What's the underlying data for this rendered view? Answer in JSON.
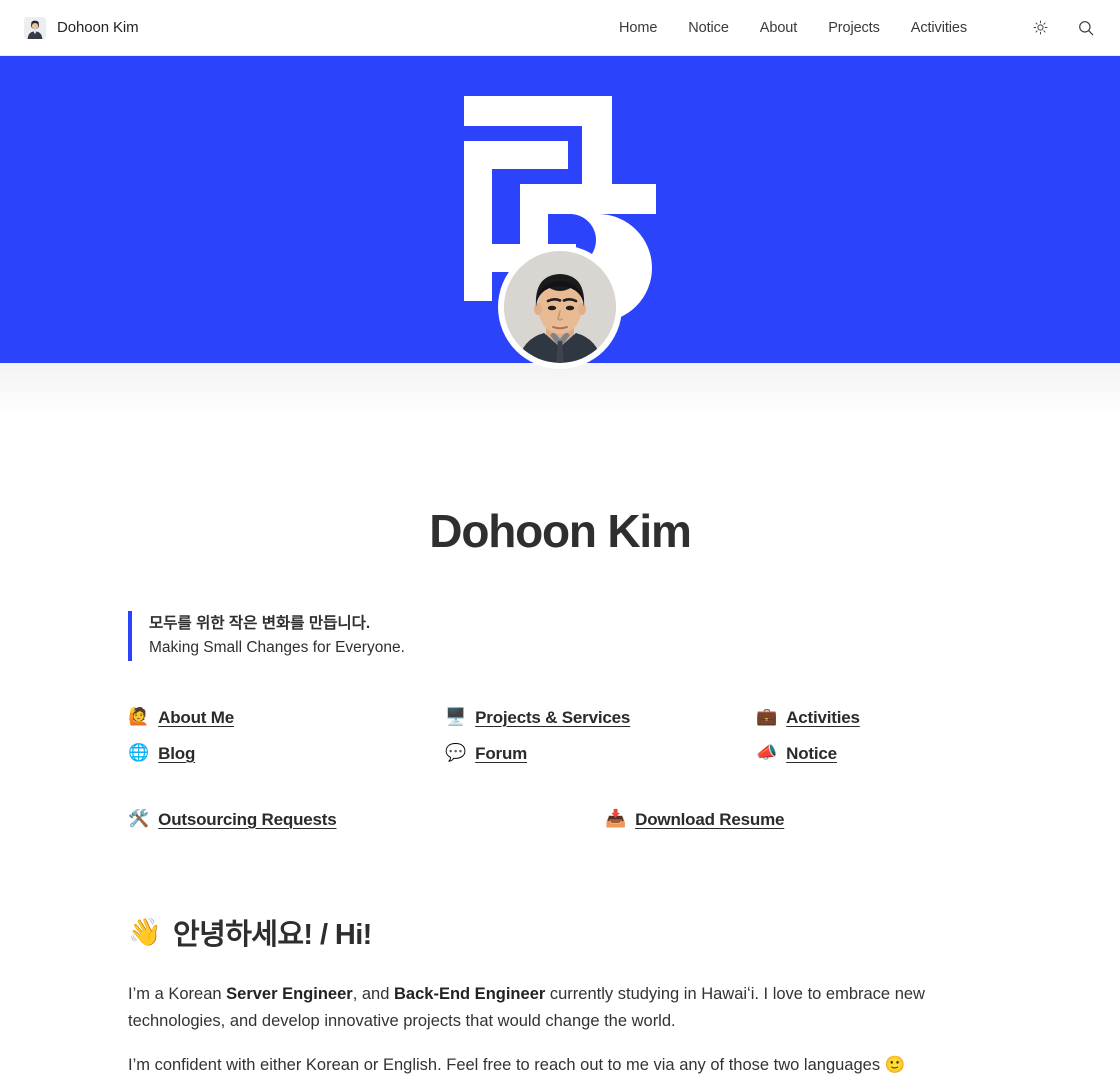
{
  "header": {
    "brand_name": "Dohoon Kim",
    "brand_avatar_icon": "user-photo-thumbnail",
    "nav_items": [
      {
        "label": "Home"
      },
      {
        "label": "Notice"
      },
      {
        "label": "About"
      },
      {
        "label": "Projects"
      },
      {
        "label": "Activities"
      }
    ],
    "theme_toggle_icon": "sun-icon",
    "search_icon": "search-icon"
  },
  "banner": {
    "background_color": "#2b44fb",
    "logo_icon": "stylized-korean-monogram-logo",
    "avatar_icon": "profile-portrait-photo"
  },
  "hero": {
    "title": "Dohoon Kim",
    "quote_ko": "모두를 위한 작은 변화를 만듭니다.",
    "quote_en": "Making Small Changes for Everyone.",
    "quote_accent_color": "#2b44fb"
  },
  "links": {
    "grid": [
      {
        "emoji": "🙋",
        "icon": "person-raising-hand-icon",
        "label": "About Me"
      },
      {
        "emoji": "🖥️",
        "icon": "desktop-computer-icon",
        "label": "Projects & Services"
      },
      {
        "emoji": "💼",
        "icon": "briefcase-icon",
        "label": "Activities"
      },
      {
        "emoji": "🌐",
        "icon": "globe-icon",
        "label": "Blog"
      },
      {
        "emoji": "💬",
        "icon": "speech-balloon-icon",
        "label": "Forum"
      },
      {
        "emoji": "📣",
        "icon": "megaphone-icon",
        "label": "Notice"
      }
    ],
    "lower": [
      {
        "emoji": "🛠️",
        "icon": "hammer-and-wrench-icon",
        "label": "Outsourcing Requests"
      },
      {
        "emoji": "📥",
        "icon": "inbox-tray-icon",
        "label": "Download Resume"
      }
    ]
  },
  "intro": {
    "heading_emoji": "👋",
    "heading_icon": "waving-hand-icon",
    "heading_text": "안녕하세요! / Hi!",
    "paragraph1": {
      "t1": "I’m a Korean ",
      "b1": "Server Engineer",
      "t2": ", and ",
      "b2": "Back-End Engineer",
      "t3": " currently studying in Hawaiʻi. I love to embrace new technologies, and develop innovative projects that would change the world."
    },
    "paragraph2": "I’m confident with either Korean or English. Feel free to reach out to me via any of those two languages 🙂"
  }
}
